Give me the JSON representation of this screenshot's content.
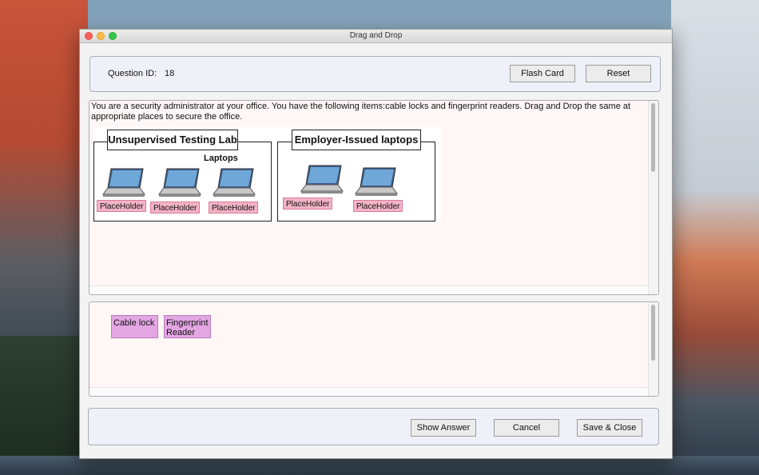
{
  "window": {
    "title": "Drag and Drop"
  },
  "header": {
    "question_id_label": "Question ID:",
    "question_id_value": "18",
    "flash_card_label": "Flash Card",
    "reset_label": "Reset"
  },
  "question": {
    "text": "You are a security administrator at your office. You have the following items:cable locks and fingerprint readers. Drag and Drop the same at appropriate places to secure the office.",
    "diagram": {
      "zone1_title": "Unsupervised Testing Lab",
      "zone1_sublabel": "Laptops",
      "zone2_title": "Employer-Issued laptops",
      "placeholders": [
        "PlaceHolder",
        "PlaceHolder",
        "PlaceHolder",
        "PlaceHolder",
        "PlaceHolder"
      ]
    }
  },
  "answers": {
    "items": [
      "Cable lock",
      "Fingerprint Reader"
    ]
  },
  "footer": {
    "show_answer_label": "Show Answer",
    "cancel_label": "Cancel",
    "save_close_label": "Save & Close"
  },
  "colors": {
    "placeholder_bg": "#f3b3c6",
    "chip_bg": "#e3a6e3",
    "content_bg": "#fff6f6",
    "panel_bg": "#eef2f8"
  }
}
